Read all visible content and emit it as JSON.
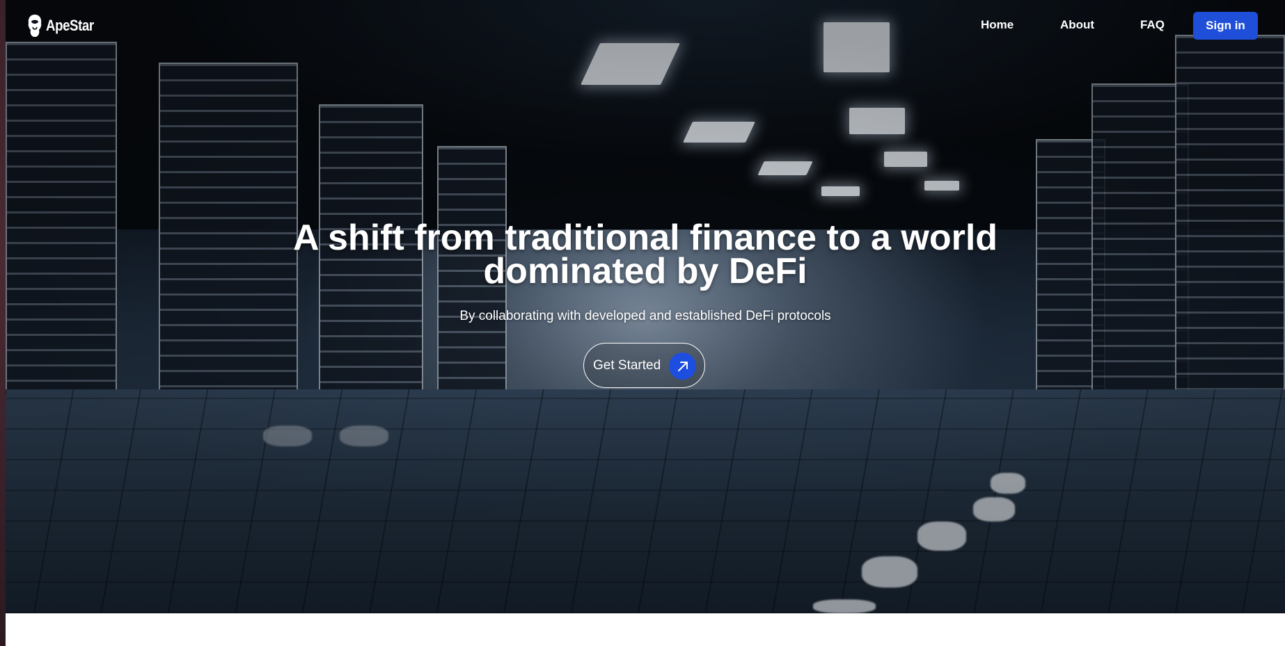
{
  "brand": {
    "name": "ApeStar"
  },
  "nav": {
    "links": [
      {
        "label": "Home"
      },
      {
        "label": "About"
      },
      {
        "label": "FAQ"
      }
    ],
    "signin_label": "Sign in"
  },
  "hero": {
    "headline_line1": "A shift from traditional finance to a world",
    "headline_line2": "dominated by DeFi",
    "subtitle": "By collaborating with developed and established DeFi protocols",
    "cta_label": "Get Started",
    "cta_icon": "arrow-up-right-icon",
    "background": "server-room-corridor-image"
  },
  "colors": {
    "accent": "#1f4fd8",
    "text": "#ffffff",
    "page": "#ffffff"
  }
}
